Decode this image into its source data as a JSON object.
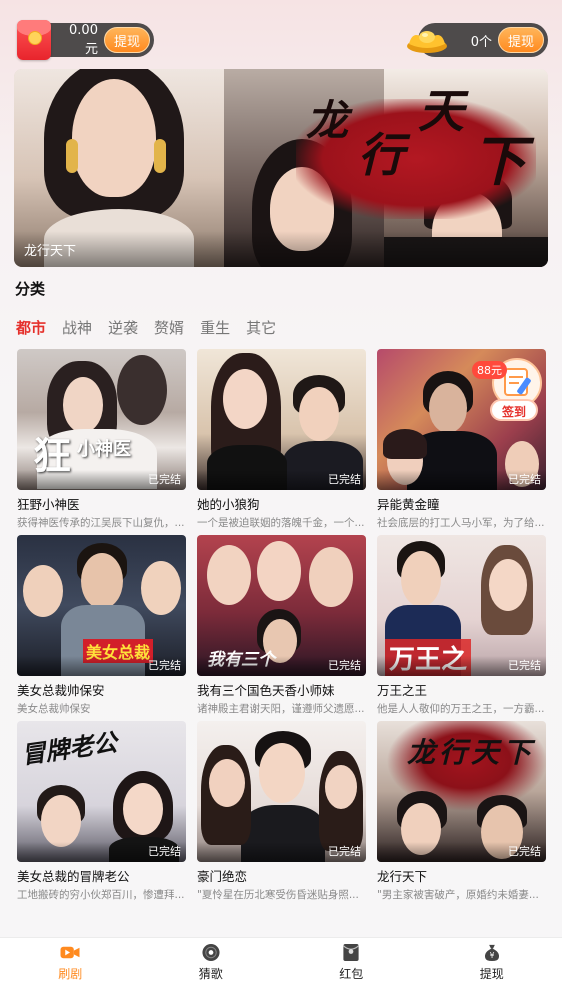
{
  "top_bar": {
    "cash": {
      "value": "0.00元",
      "button": "提现",
      "icon": "red-packet-icon"
    },
    "coins": {
      "value": "0个",
      "button": "提现",
      "icon": "gold-ingot-icon"
    }
  },
  "banner": {
    "caption": "龙行天下",
    "artwork_text": [
      "龙",
      "行",
      "天",
      "下"
    ]
  },
  "category": {
    "title": "分类",
    "tabs": [
      "都市",
      "战神",
      "逆袭",
      "赘婿",
      "重生",
      "其它"
    ],
    "active_tab": "都市"
  },
  "dramas": [
    {
      "title": "狂野小神医",
      "desc": "获得神医传承的江吴辰下山复仇，...",
      "status": "已完结",
      "cover_text": "狂野小神医"
    },
    {
      "title": "她的小狼狗",
      "desc": "一个是被迫联姻的落魄千金，一个...",
      "status": "已完结",
      "cover_text": ""
    },
    {
      "title": "异能黄金瞳",
      "desc": "社会底层的打工人马小军，为了给...",
      "status": "已完结",
      "cover_text": "",
      "price_badge": "88元",
      "sign_label": "签到"
    },
    {
      "title": "美女总裁帅保安",
      "desc": "美女总裁帅保安",
      "status": "已完结",
      "cover_text": "美女总裁"
    },
    {
      "title": "我有三个国色天香小师妹",
      "desc": "诸神殿主君谢天阳，谨遵师父遗愿...",
      "status": "已完结",
      "cover_text": "我有三个"
    },
    {
      "title": "万王之王",
      "desc": "他是人人敬仰的万王之王，一方霸...",
      "status": "已完结",
      "cover_text": "万王之"
    },
    {
      "title": "美女总裁的冒牌老公",
      "desc": "工地搬砖的穷小伙郑百川，惨遭拜...",
      "status": "已完结",
      "cover_text": "冒牌老公"
    },
    {
      "title": "豪门绝恋",
      "desc": "\"夏怜星在历北寒受伤昏迷贴身照...",
      "status": "已完结",
      "cover_text": ""
    },
    {
      "title": "龙行天下",
      "desc": "\"男主家被害破产，原婚约未婚妻...",
      "status": "已完结",
      "cover_text": "龙行天下"
    }
  ],
  "bottom_nav": [
    {
      "label": "刷剧",
      "icon": "video-icon",
      "active": true
    },
    {
      "label": "猜歌",
      "icon": "music-disc-icon",
      "active": false
    },
    {
      "label": "红包",
      "icon": "red-packet-icon",
      "active": false
    },
    {
      "label": "提现",
      "icon": "money-bag-icon",
      "active": false
    }
  ],
  "colors": {
    "accent": "#ff8a1f",
    "active_tab": "#e5302b"
  }
}
